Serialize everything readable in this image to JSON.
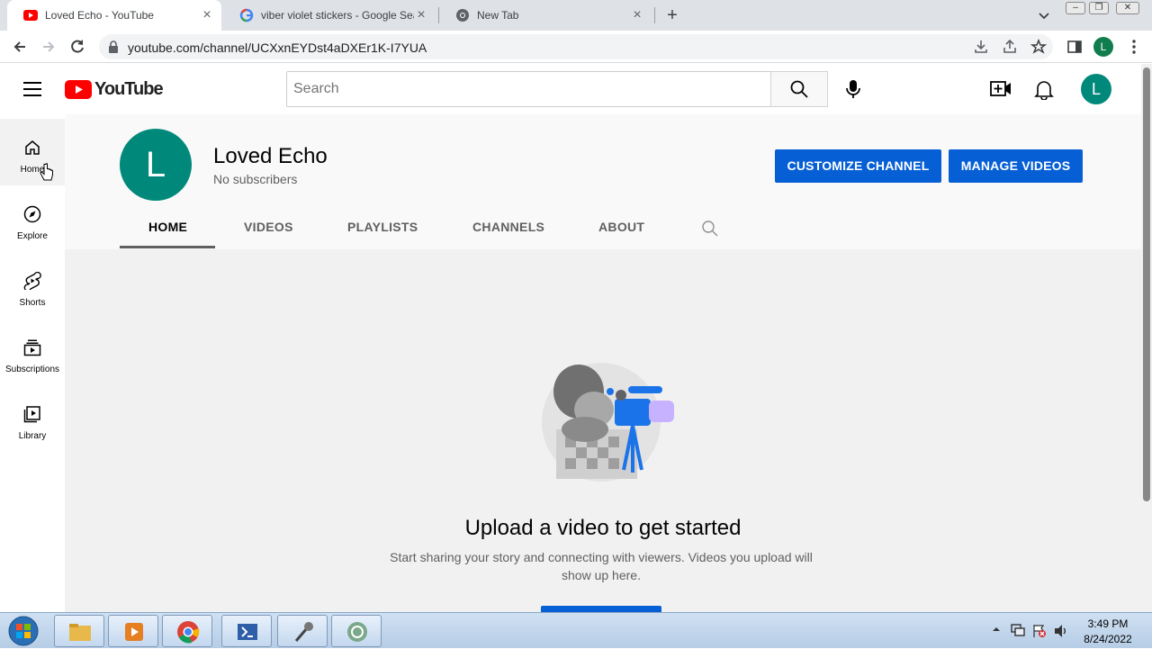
{
  "browser": {
    "tabs": [
      {
        "title": "Loved Echo - YouTube",
        "favicon": "youtube-icon",
        "active": true
      },
      {
        "title": "viber violet stickers - Google Sea",
        "favicon": "google-icon",
        "active": false
      },
      {
        "title": "New Tab",
        "favicon": "chrome-icon",
        "active": false
      }
    ],
    "url": "youtube.com/channel/UCXxnEYDst4aDXEr1K-I7YUA",
    "profile_initial": "L"
  },
  "youtube": {
    "logo_text": "YouTube",
    "search_placeholder": "Search",
    "avatar_initial": "L",
    "sidebar": [
      {
        "label": "Home",
        "icon": "home-icon",
        "selected": true
      },
      {
        "label": "Explore",
        "icon": "compass-icon",
        "selected": false
      },
      {
        "label": "Shorts",
        "icon": "shorts-icon",
        "selected": false
      },
      {
        "label": "Subscriptions",
        "icon": "subscriptions-icon",
        "selected": false
      },
      {
        "label": "Library",
        "icon": "library-icon",
        "selected": false
      }
    ],
    "channel": {
      "avatar_initial": "L",
      "name": "Loved Echo",
      "subscribers": "No subscribers",
      "customize_label": "CUSTOMIZE CHANNEL",
      "manage_label": "MANAGE VIDEOS",
      "tabs": [
        "HOME",
        "VIDEOS",
        "PLAYLISTS",
        "CHANNELS",
        "ABOUT"
      ],
      "active_tab": "HOME"
    },
    "empty_state": {
      "title": "Upload a video to get started",
      "description": "Start sharing your story and connecting with viewers. Videos you upload will show up here."
    }
  },
  "taskbar": {
    "apps": [
      "file-explorer-icon",
      "media-player-icon",
      "chrome-icon",
      "powershell-icon",
      "microphone-icon",
      "network-app-icon"
    ],
    "time": "3:49 PM",
    "date": "8/24/2022"
  },
  "colors": {
    "youtube_red": "#ff0000",
    "primary_blue": "#065fd4",
    "avatar_teal": "#00897b"
  }
}
